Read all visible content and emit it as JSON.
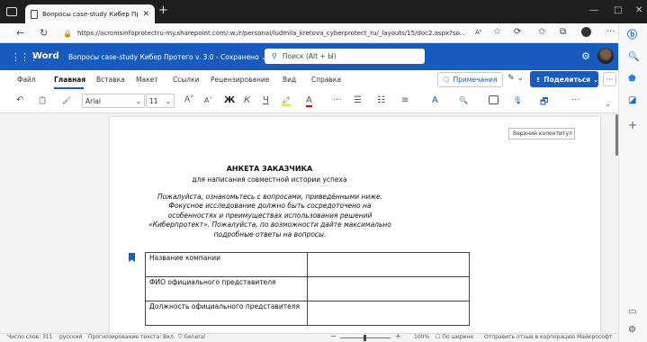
{
  "browser": {
    "tab_title": "Вопросы case-study Кибер Прот",
    "tab_close": "✕",
    "new_tab": "+",
    "url": "https://acronisinfoprotectru-my.sharepoint.com/:w:/r/personal/ludmila_kretova_cyberprotect_ru/_layouts/15/doc2.aspx?so...",
    "url_icons": "Aʰ",
    "window_controls": [
      "—",
      "□",
      "✕"
    ]
  },
  "word": {
    "app_name": "Word",
    "doc_title": "Вопросы case-study Кибер Протего v. 3.0 - Сохранено",
    "search_placeholder": "Поиск (Alt + Ы)",
    "menu": [
      "Файл",
      "Главная",
      "Вставка",
      "Макет",
      "Ссылки",
      "Рецензирование",
      "Вид",
      "Справка"
    ],
    "comments": "Примечания",
    "share": "Поделиться",
    "more": "···",
    "font": "Arial",
    "font_size": "11"
  },
  "ribbon_glyphs": {
    "undo": "↶",
    "paste": "📋",
    "brush": "🖌",
    "grow": "A˄",
    "shrink": "A˅",
    "bold": "Ж",
    "italic": "К",
    "underline": "Ч",
    "highlight": "🖍",
    "fontcolor": "A",
    "more": "···",
    "bullets": "☰",
    "numbering": "☷",
    "align": "≡",
    "styles": "A",
    "find": "🔍",
    "dictate": "🎙",
    "designer": "🗗"
  },
  "document": {
    "tooltip": "Верхний колонтитул",
    "heading": "АНКЕТА ЗАКАЗЧИКА",
    "subheading": "для написания совместной истории успеха",
    "intro": "Пожалуйста, ознакомьтесь с вопросами, приведёнными ниже. Фокусное исследование должно быть сосредоточено на особенностях и преимуществах использования решений «Киберпротект». Пожалуйста, по возможности дайте максимально подробные ответы на вопросы.",
    "table_rows": [
      "Название компании",
      "ФИО официального представителя",
      "Должность официального представителя"
    ]
  },
  "status": {
    "words": "Число слов: 311",
    "language": "русский",
    "predict": "Прогнозирование текста: Вкл.",
    "sensitivity": "General",
    "zoom": "100%",
    "fit": "По ширине",
    "feedback": "Отправить отзыв в корпорацию Майкрософт"
  },
  "colors": {
    "word_blue": "#185abd",
    "title_bar": "#1f1f1f"
  }
}
